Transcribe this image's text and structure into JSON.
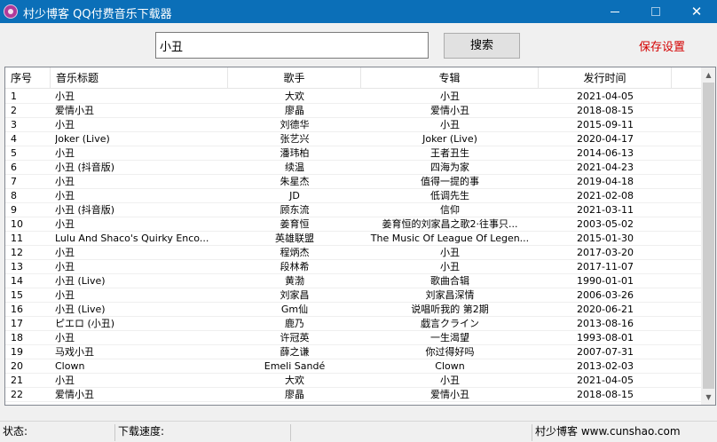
{
  "window": {
    "title": "村少博客 QQ付费音乐下载器",
    "minimize_glyph": "",
    "close_glyph": "✕"
  },
  "search": {
    "value": "小丑",
    "button_label": "搜索"
  },
  "save_settings_label": "保存设置",
  "table": {
    "columns": [
      "序号",
      "音乐标题",
      "歌手",
      "专辑",
      "发行时间"
    ],
    "rows": [
      [
        "1",
        "小丑",
        "大欢",
        "小丑",
        "2021-04-05"
      ],
      [
        "2",
        "爱情小丑",
        "廖晶",
        "爱情小丑",
        "2018-08-15"
      ],
      [
        "3",
        "小丑",
        "刘德华",
        "小丑",
        "2015-09-11"
      ],
      [
        "4",
        "Joker (Live)",
        "张艺兴",
        "Joker (Live)",
        "2020-04-17"
      ],
      [
        "5",
        "小丑",
        "潘玮柏",
        "王者丑生",
        "2014-06-13"
      ],
      [
        "6",
        "小丑 (抖音版)",
        "续温",
        "四海为家",
        "2021-04-23"
      ],
      [
        "7",
        "小丑",
        "朱星杰",
        "值得一提的事",
        "2019-04-18"
      ],
      [
        "8",
        "小丑",
        "JD",
        "低调先生",
        "2021-02-08"
      ],
      [
        "9",
        "小丑 (抖音版)",
        "顾东流",
        "信仰",
        "2021-03-11"
      ],
      [
        "10",
        "小丑",
        "姜育恒",
        "姜育恒的刘家昌之歌2·往事只...",
        "2003-05-02"
      ],
      [
        "11",
        "Lulu And Shaco's Quirky Enco...",
        "英雄联盟",
        "The Music Of League Of Legen...",
        "2015-01-30"
      ],
      [
        "12",
        "小丑",
        "程炳杰",
        "小丑",
        "2017-03-20"
      ],
      [
        "13",
        "小丑",
        "段林希",
        "小丑",
        "2017-11-07"
      ],
      [
        "14",
        "小丑 (Live)",
        "黄渤",
        "歌曲合辑",
        "1990-01-01"
      ],
      [
        "15",
        "小丑",
        "刘家昌",
        "刘家昌深情",
        "2006-03-26"
      ],
      [
        "16",
        "小丑 (Live)",
        "Gm仙",
        "说唱听我的 第2期",
        "2020-06-21"
      ],
      [
        "17",
        "ピエロ (小丑)",
        "鹿乃",
        "戯言クライン",
        "2013-08-16"
      ],
      [
        "18",
        "小丑",
        "许冠英",
        "一生渴望",
        "1993-08-01"
      ],
      [
        "19",
        "马戏小丑",
        "薛之谦",
        "你过得好吗",
        "2007-07-31"
      ],
      [
        "20",
        "Clown",
        "Emeli Sandé",
        "Clown",
        "2013-02-03"
      ],
      [
        "21",
        "小丑",
        "大欢",
        "小丑",
        "2021-04-05"
      ],
      [
        "22",
        "爱情小丑",
        "廖晶",
        "爱情小丑",
        "2018-08-15"
      ]
    ]
  },
  "status_bar": {
    "status_label": "状态:",
    "speed_label": "下载速度:",
    "empty": "",
    "blog": "村少博客 www.cunshao.com"
  }
}
